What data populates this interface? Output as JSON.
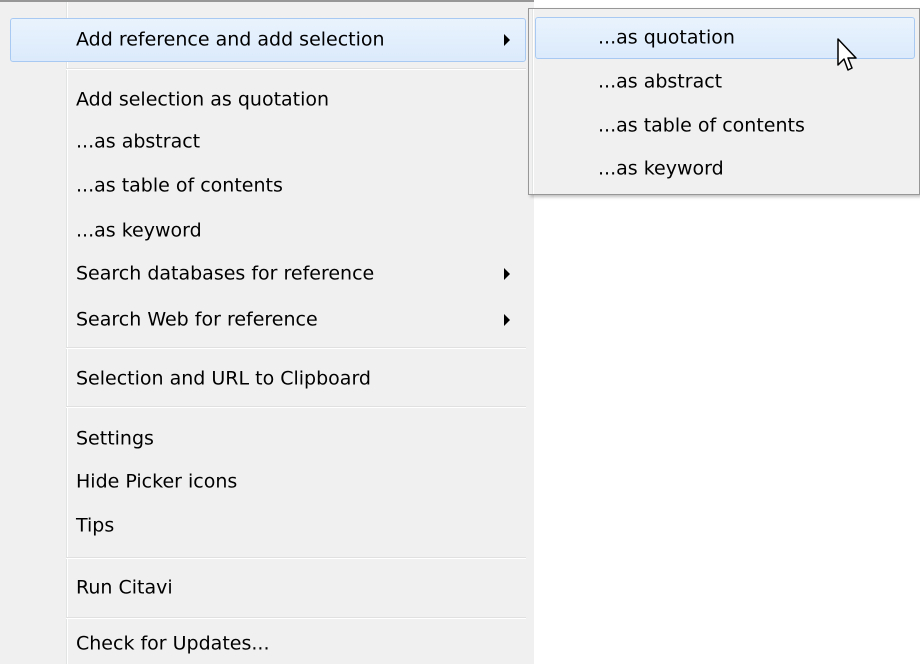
{
  "menu": {
    "items": [
      {
        "label": "Add reference and add selection",
        "submenu": true,
        "highlighted": true
      },
      {
        "label": "Add selection as quotation"
      },
      {
        "label": "...as abstract"
      },
      {
        "label": "...as table of contents"
      },
      {
        "label": "...as keyword"
      },
      {
        "label": "Search databases for reference",
        "submenu": true
      },
      {
        "label": "Search Web for reference",
        "submenu": true
      },
      {
        "label": "Selection and URL to Clipboard"
      },
      {
        "label": "Settings"
      },
      {
        "label": "Hide Picker icons"
      },
      {
        "label": "Tips"
      },
      {
        "label": "Run Citavi"
      },
      {
        "label": "Check for Updates..."
      }
    ]
  },
  "submenu": {
    "items": [
      {
        "label": "...as quotation",
        "highlighted": true
      },
      {
        "label": "...as abstract"
      },
      {
        "label": "...as table of contents"
      },
      {
        "label": "...as keyword"
      }
    ]
  },
  "colors": {
    "menu_background": "#f0f0f0",
    "highlight_border": "#a8caf2",
    "highlight_fill": "#dbeafc",
    "separator": "#e0e0e0"
  },
  "icons": {
    "submenu_arrow": "triangle-right",
    "cursor": "arrow-pointer"
  }
}
